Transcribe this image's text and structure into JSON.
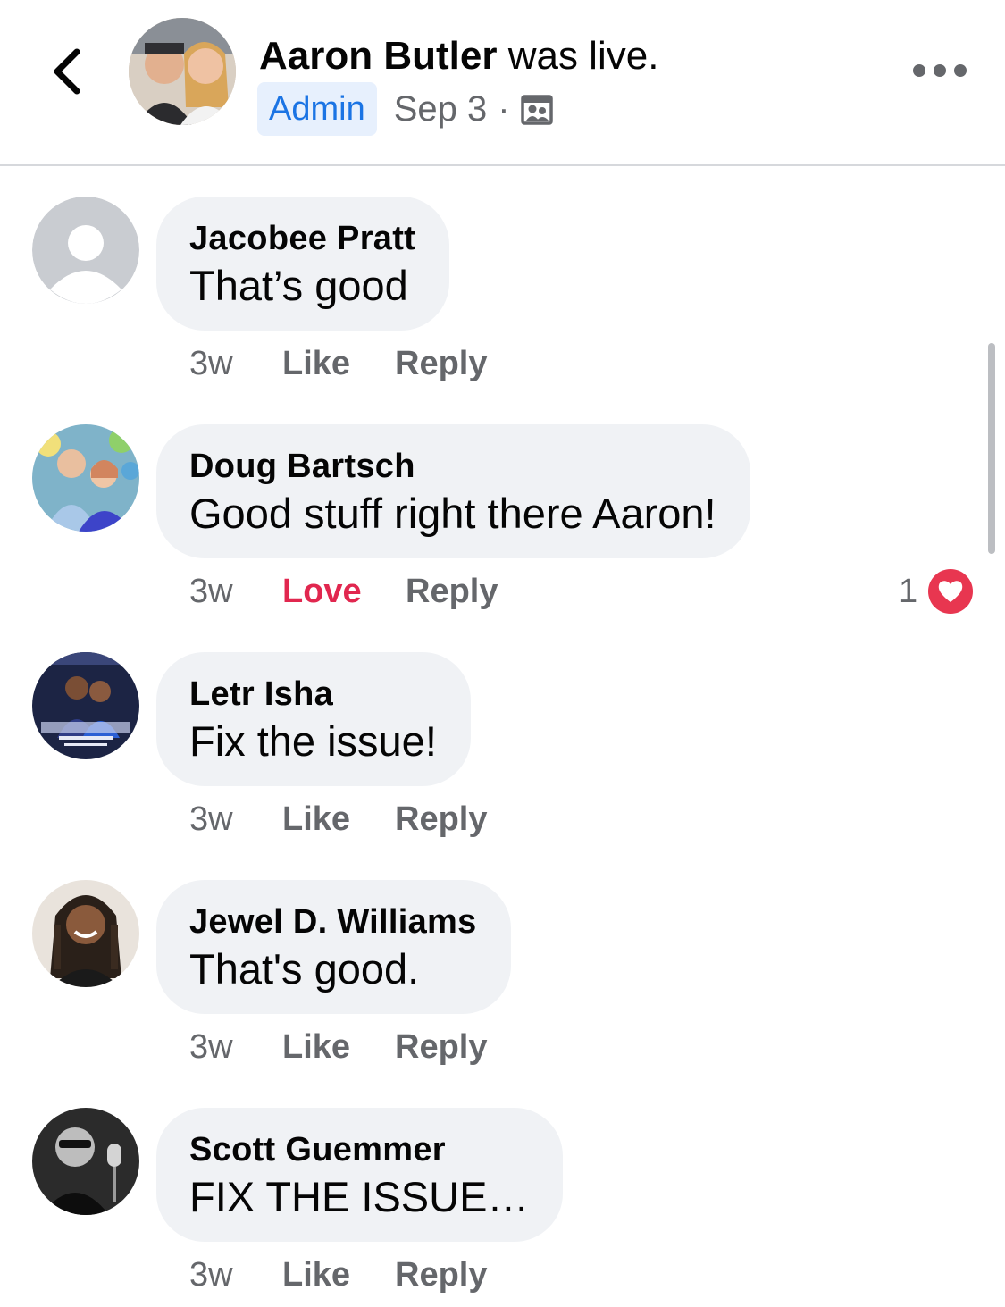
{
  "header": {
    "title_name": "Aaron Butler",
    "title_suffix": " was live.",
    "badge": "Admin",
    "date": "Sep 3",
    "separator": "·",
    "icons": {
      "back": "chevron-left-icon",
      "audience": "group-audience-icon",
      "more": "more-options-icon"
    }
  },
  "colors": {
    "accent_blue": "#1b74e4",
    "badge_bg": "#e7f0fd",
    "bubble_bg": "#f0f2f5",
    "secondary_text": "#65676b",
    "love_red": "#e1274f",
    "heart_badge": "#e83650"
  },
  "comments": [
    {
      "name": "Jacobee Pratt",
      "text": "That’s good",
      "time": "3w",
      "reaction_label": "Like",
      "reply_label": "Reply",
      "avatar": "default-avatar-icon"
    },
    {
      "name": "Doug Bartsch",
      "text": "Good stuff right there Aaron!",
      "time": "3w",
      "reaction_label": "Love",
      "reply_label": "Reply",
      "reaction_count": "1",
      "reaction_icon": "heart-icon",
      "avatar": "user-photo"
    },
    {
      "name": "Letr Isha",
      "text": "Fix the issue!",
      "time": "3w",
      "reaction_label": "Like",
      "reply_label": "Reply",
      "avatar": "user-photo"
    },
    {
      "name": "Jewel D. Williams",
      "text": "That's good.",
      "time": "3w",
      "reaction_label": "Like",
      "reply_label": "Reply",
      "avatar": "user-photo"
    },
    {
      "name": "Scott Guemmer",
      "text": "FIX THE ISSUE…",
      "time": "3w",
      "reaction_label": "Like",
      "reply_label": "Reply",
      "avatar": "user-photo"
    }
  ]
}
